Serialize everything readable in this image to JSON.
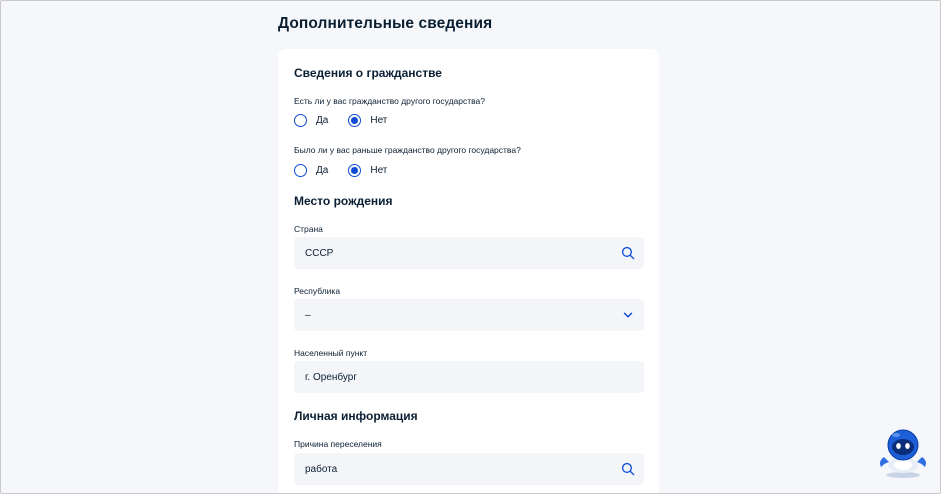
{
  "page": {
    "title": "Дополнительные сведения"
  },
  "citizenship": {
    "title": "Сведения о гражданстве",
    "q1": {
      "question": "Есть ли у вас гражданство другого государства?",
      "options": [
        "Да",
        "Нет"
      ],
      "selected": "Нет"
    },
    "q2": {
      "question": "Было ли у вас раньше гражданство другого государства?",
      "options": [
        "Да",
        "Нет"
      ],
      "selected": "Нет"
    }
  },
  "birthplace": {
    "title": "Место рождения",
    "country": {
      "label": "Страна",
      "value": "СССР",
      "icon": "search-icon"
    },
    "republic": {
      "label": "Республика",
      "value": "–",
      "icon": "chevron-down-icon"
    },
    "locality": {
      "label": "Населенный пункт",
      "value": "г. Оренбург"
    }
  },
  "personal": {
    "title": "Личная информация",
    "reason": {
      "label": "Причина переселения",
      "value": "работа",
      "icon": "search-icon"
    }
  },
  "colors": {
    "accent": "#0d4cd3",
    "background": "#f5f7fb",
    "field": "#f3f5f8",
    "text": "#0b1f33"
  }
}
